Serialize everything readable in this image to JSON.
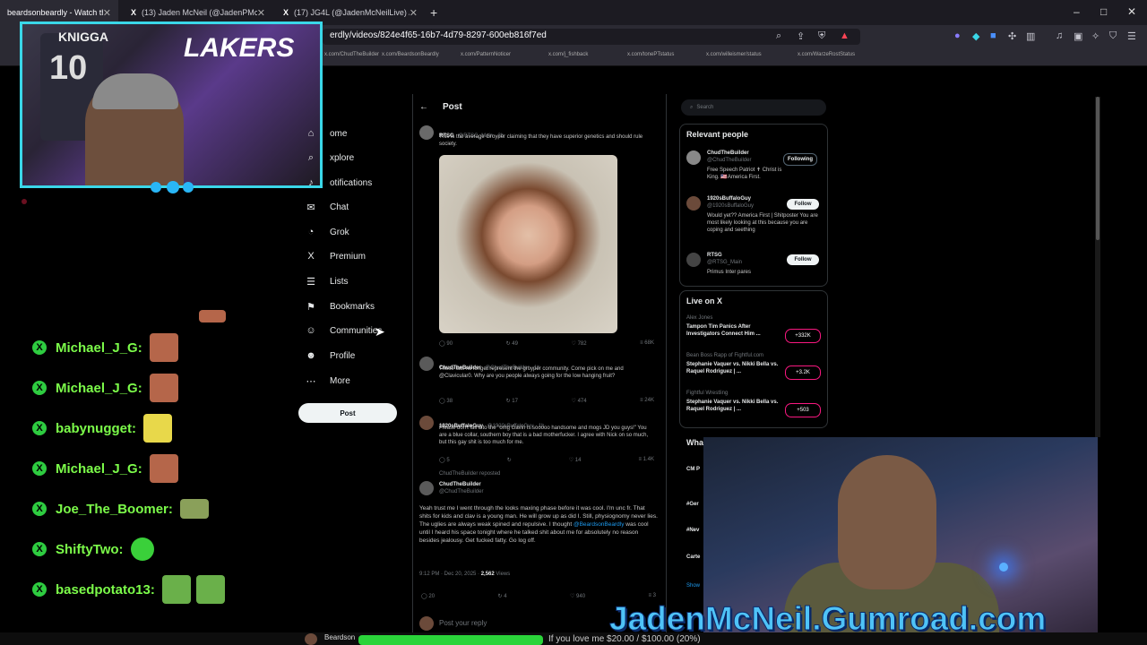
{
  "browser": {
    "tabs": [
      {
        "label": "beardsonbeardly - Watch the",
        "active": true
      },
      {
        "label": "(13) Jaden McNeil (@JadenPMcNeil",
        "active": false
      },
      {
        "label": "(17) JG4L (@JadenMcNeilLive) / X",
        "active": false
      }
    ],
    "new_tab": "+",
    "url": "erdly/videos/824e4f65-16b7-4d79-8297-600eb816f7ed",
    "window_controls": [
      "–",
      "□",
      "✕"
    ],
    "bookmarks": [
      "x.com/ChudTheBuilder",
      "x.com/BeardsonBeardly",
      "x.com/PatternNoticer",
      "x.com/j_fishback",
      "x.com/tonePTstatus",
      "x.com/willeismer/status",
      "x.com/WarzeRostStatus"
    ]
  },
  "webcam_top": {
    "jersey_text": "KNIGGA",
    "jersey_number": "10",
    "banner": "LAKERS"
  },
  "chat": [
    {
      "user": "Michael_J_G:",
      "badge": "X",
      "emote_color": "#b5664a"
    },
    {
      "user": "Michael_J_G:",
      "badge": "X",
      "emote_color": "#b5664a"
    },
    {
      "user": "babynugget:",
      "badge": "X",
      "emote_color": "#e8d84a"
    },
    {
      "user": "Michael_J_G:",
      "badge": "X",
      "emote_color": "#b5664a"
    },
    {
      "user": "Joe_The_Boomer:",
      "badge": "X",
      "emote_color": "#8aa05a"
    },
    {
      "user": "ShiftyTwo:",
      "badge": "X",
      "emote_color": "#3ad03a"
    },
    {
      "user": "basedpotato13:",
      "badge": "X",
      "emote_color": "#6ab04a"
    }
  ],
  "x_nav": [
    {
      "label": "ome",
      "icon": "⌂"
    },
    {
      "label": "xplore",
      "icon": "⌕"
    },
    {
      "label": "otifications",
      "icon": "♪"
    },
    {
      "label": "Chat",
      "icon": "✉"
    },
    {
      "label": "Grok",
      "icon": "◔"
    },
    {
      "label": "Premium",
      "icon": "X"
    },
    {
      "label": "Lists",
      "icon": "☰"
    },
    {
      "label": "Bookmarks",
      "icon": "⚑"
    },
    {
      "label": "Communities",
      "icon": "☺"
    },
    {
      "label": "Profile",
      "icon": "☻"
    },
    {
      "label": "More",
      "icon": "⋯"
    }
  ],
  "post_button": "Post",
  "post_header": {
    "back": "←",
    "title": "Post"
  },
  "main_post": {
    "name": "RTSG",
    "handle": "@RTSG_Main · 2h",
    "text": "This is the average Groyper claiming that they have superior genetics and should rule society.",
    "actions": [
      "◯ 90",
      "↻ 49",
      "♡ 782",
      "≡ 68K"
    ]
  },
  "replies": [
    {
      "name": "ChudTheBuilder",
      "handle": "@ChudTheBuilder · 1h",
      "text": "These fats no longer represent the groyper community. Come pick on me and @Clavicular0. Why are you people always going for the low hanging fruit?",
      "actions": [
        "◯ 38",
        "↻ 17",
        "♡ 474",
        "≡ 24K"
      ]
    },
    {
      "name": "1920sBuffaloGuy",
      "handle": "@1920sBuffaloGuy · 1h",
      "text": "Please don't fall into the \"omg Gavin is sooooo handsome and mogs JD you guys!\" You are a blue collar, southern boy that is a bad motherfucker. I agree with Nick on so much, but this gay shit is too much for me.",
      "actions": [
        "◯ 5",
        "↻",
        "♡ 14",
        "≡ 1.4K"
      ]
    },
    {
      "reposted": "ChudTheBuilder reposted",
      "name": "ChudTheBuilder",
      "handle": "@ChudTheBuilder",
      "text_parts": [
        "Yeah trust me I went through the looks maxing phase before it was cool. I'm unc fr. That shits for kids and clav is a young man. He will grow up as did I. Still, physiognomy never lies. The uglies are always weak spined and repulsive. I thought ",
        "@BeardsonBeardly",
        " was cool until I heard his space tonight where he talked shit about me for absolutely no reason besides jealousy. Get fucked fatty. Go log off."
      ],
      "timestamp": "9:12 PM · Dec 20, 2025 · ",
      "views": "2,562",
      "views_label": " Views",
      "actions": [
        "◯ 20",
        "↻ 4",
        "♡ 940",
        "≡ 3"
      ]
    }
  ],
  "reply_box": {
    "placeholder": "Post your reply"
  },
  "right": {
    "search": "Search",
    "relevant_title": "Relevant people",
    "people": [
      {
        "name": "ChudTheBuilder",
        "handle": "@ChudTheBuilder",
        "bio": "Free Speech Patriot ✝ Christ is King. 🇺🇸America First.",
        "button": "Following",
        "following": true
      },
      {
        "name": "1920sBuffaloGuy",
        "handle": "@1920sBuffaloGuy",
        "bio": "Would yet?? America First | Shitposter You are most likely looking at this because you are coping and seething",
        "button": "Follow",
        "following": false
      },
      {
        "name": "RTSG",
        "handle": "@RTSG_Main",
        "bio": "Primus Inter pares",
        "button": "Follow",
        "following": false
      }
    ],
    "live_title": "Live on X",
    "live": [
      {
        "host": "Alex Jones",
        "title": "Tampon Tim Panics After Investigators Connect Him ...",
        "count": "+332K"
      },
      {
        "host": "Bean Boss Rapp of Fightful.com",
        "title": "Stephanie Vaquer vs. Nikki Bella vs. Raquel Rodriguez | ...",
        "count": "+3.2K"
      },
      {
        "host": "Fightful Wrestling",
        "title": "Stephanie Vaquer vs. Nikki Bella vs. Raquel Rodriguez | ...",
        "count": "+503"
      }
    ],
    "whats_title": "Wha",
    "partial_items": [
      "CM P",
      "#Ger",
      "#Nev",
      "Carte",
      "Show"
    ]
  },
  "overlay": {
    "gumroad": "JadenMcNeil.Gumroad.com",
    "ticker": "If you love me $20.00 / $100.00 (20%)",
    "bottom_user": "Beardson"
  }
}
